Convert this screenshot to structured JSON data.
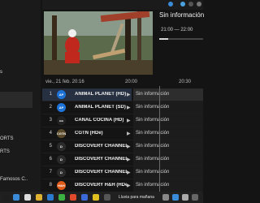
{
  "sidebar": {
    "items": [
      {
        "label": "s"
      },
      {
        "label": "ORTS"
      },
      {
        "label": "RTS"
      },
      {
        "label": "Famosos C.."
      }
    ]
  },
  "info": {
    "title": "Sin información",
    "time_range": "21:00 — 22:00",
    "progress": 0.2
  },
  "timeline": {
    "date": "vie., 21 feb. 20:16",
    "t1": "20:00",
    "t2": "20:30"
  },
  "channels": [
    {
      "num": "1",
      "name": "ANIMAL PLANET (HD)",
      "logo": "AP",
      "logo_color": "#1e73d8",
      "program": "Sin información"
    },
    {
      "num": "2",
      "name": "ANIMAL PLANET (SD)",
      "logo": "AP",
      "logo_color": "#1e73d8",
      "program": "Sin información"
    },
    {
      "num": "3",
      "name": "CANAL COCINA (HD)",
      "logo": "co",
      "logo_color": "#222222",
      "program": "Sin información"
    },
    {
      "num": "4",
      "name": "CGTN (HDe)",
      "logo": "CGTN",
      "logo_color": "#5a4a2a",
      "program": "Sin información"
    },
    {
      "num": "5",
      "name": "DISCOVERY CHANNEL (...",
      "logo": "D",
      "logo_color": "#2b2b2b",
      "program": "Sin información"
    },
    {
      "num": "6",
      "name": "DISCOVERY CHANNEL...",
      "logo": "D",
      "logo_color": "#2b2b2b",
      "program": "Sin información"
    },
    {
      "num": "7",
      "name": "DISCOVERY CHANNEL...",
      "logo": "D",
      "logo_color": "#2b2b2b",
      "program": "Sin información"
    },
    {
      "num": "8",
      "name": "DISCOVERY H&H (HDe)",
      "logo": "H&H",
      "logo_color": "#e05a1a",
      "program": "Sin información"
    }
  ],
  "taskbar": {
    "weather": "Lluvia para mañana"
  }
}
